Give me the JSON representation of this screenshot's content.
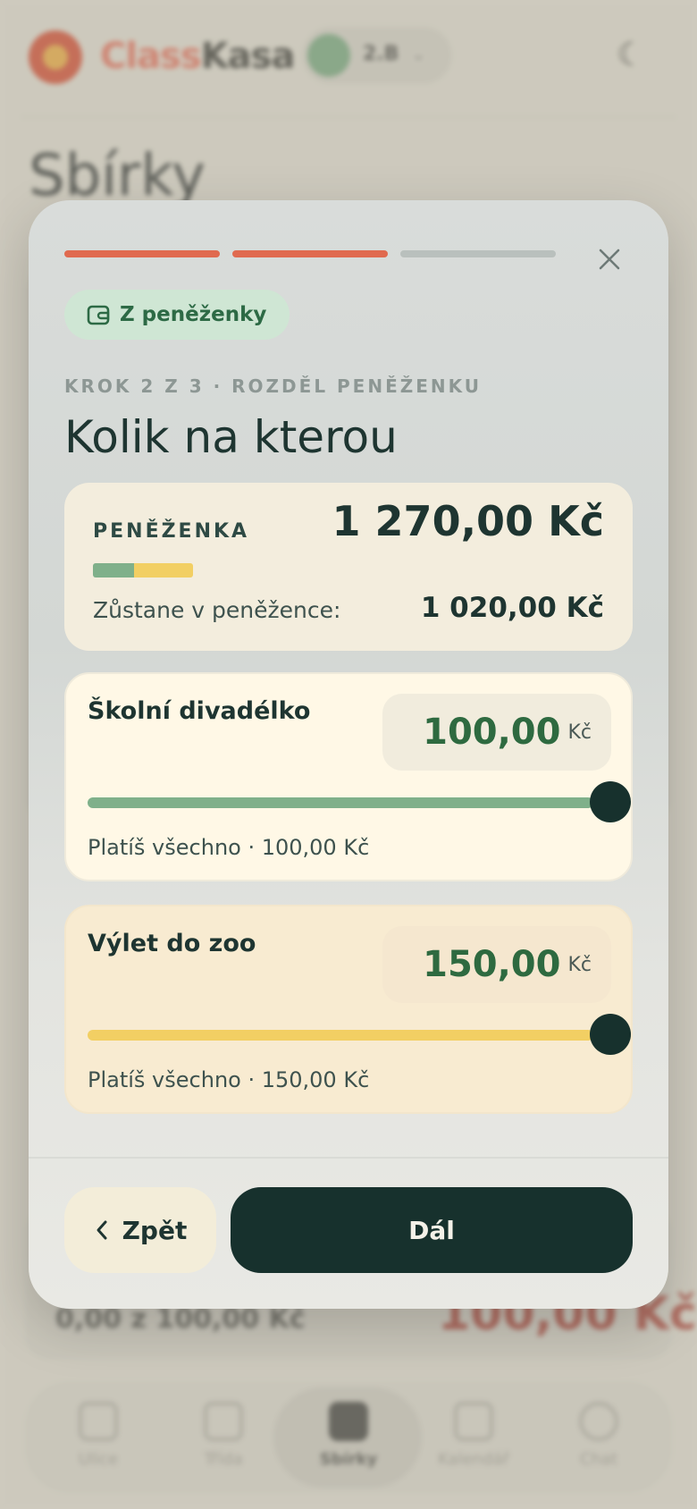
{
  "background": {
    "brand_part1": "Class",
    "brand_part2": "Kasa",
    "class_selector": "2.B",
    "page_title": "Sbírky",
    "bottom_card_progress": "0,00 z 100,00 Kč",
    "bottom_card_amount": "100,00 Kč",
    "nav": [
      {
        "label": "Ulice",
        "icon": "home-icon"
      },
      {
        "label": "Třída",
        "icon": "people-icon"
      },
      {
        "label": "Sbírky",
        "icon": "wallet-icon",
        "active": true
      },
      {
        "label": "Kalendář",
        "icon": "calendar-icon"
      },
      {
        "label": "Chat",
        "icon": "chat-icon"
      }
    ]
  },
  "modal": {
    "progress_steps_total": 3,
    "progress_steps_done": 2,
    "source_label": "Z peněženky",
    "step_label": "Krok 2 z 3 · Rozděl peněženku",
    "heading": "Kolik na kterou",
    "wallet": {
      "label": "PENĚŽENKA",
      "total": "1 270,00 Kč",
      "remaining_label": "Zůstane v peněžence:",
      "remaining_value": "1 020,00 Kč"
    },
    "allocations": [
      {
        "name": "Školní divadélko",
        "amount": "100,00",
        "currency": "Kč",
        "slider_fraction": 1.0,
        "note": "Platíš všechno · 100,00 Kč",
        "color": "#7fb08a"
      },
      {
        "name": "Výlet do zoo",
        "amount": "150,00",
        "currency": "Kč",
        "slider_fraction": 1.0,
        "note": "Platíš všechno · 150,00 Kč",
        "color": "#f2cf63"
      }
    ],
    "back_label": "Zpět",
    "next_label": "Dál"
  },
  "colors": {
    "accent": "#e06a4f",
    "primary_dark": "#17312d",
    "green": "#7fb08a",
    "yellow": "#f2cf63"
  }
}
